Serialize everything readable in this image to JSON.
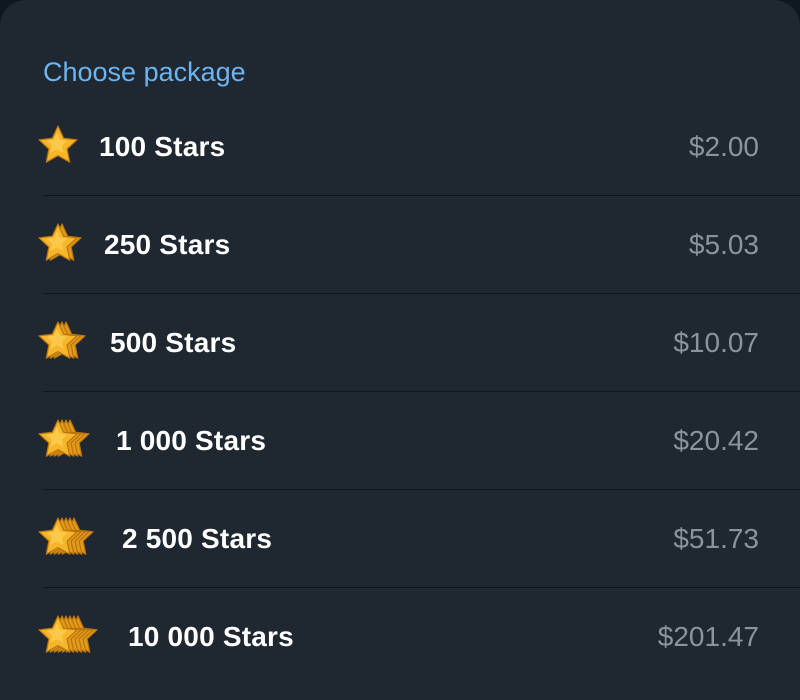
{
  "header": {
    "title": "Choose package"
  },
  "packages": [
    {
      "label": "100 Stars",
      "price": "$2.00",
      "icon": "star-stack-1-icon"
    },
    {
      "label": "250 Stars",
      "price": "$5.03",
      "icon": "star-stack-2-icon"
    },
    {
      "label": "500 Stars",
      "price": "$10.07",
      "icon": "star-stack-3-icon"
    },
    {
      "label": "1 000 Stars",
      "price": "$20.42",
      "icon": "star-stack-4-icon"
    },
    {
      "label": "2 500 Stars",
      "price": "$51.73",
      "icon": "star-stack-5-icon"
    },
    {
      "label": "10 000 Stars",
      "price": "$201.47",
      "icon": "star-stack-6-icon"
    }
  ],
  "colors": {
    "background": "#1f2731",
    "accent": "#6cb5f0",
    "star_fill": "#f7b529",
    "price_text": "#8c939c"
  }
}
